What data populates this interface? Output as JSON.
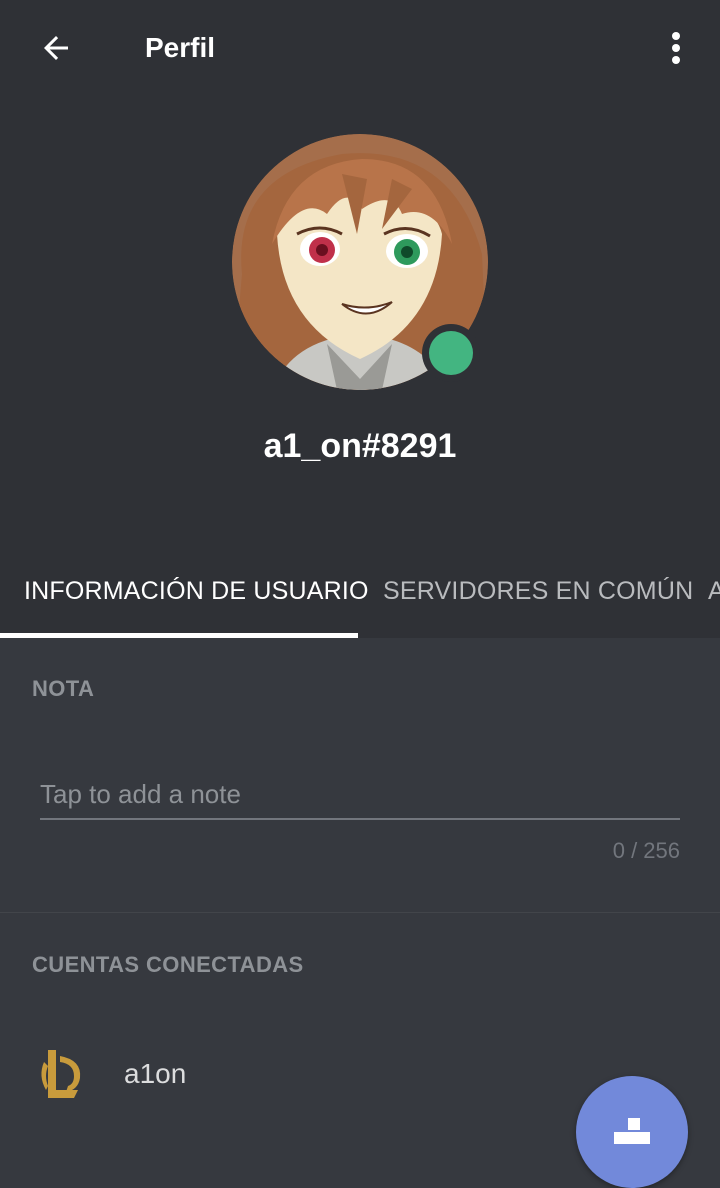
{
  "header": {
    "title": "Perfil",
    "back_icon": "arrow-left-icon",
    "more_icon": "more-vertical-icon"
  },
  "profile": {
    "username": "a1_on#8291",
    "status": "online",
    "status_color": "#43b581"
  },
  "tabs": [
    {
      "label": "INFORMACIÓN DE USUARIO",
      "active": true
    },
    {
      "label": "SERVIDORES EN COMÚN",
      "active": false
    },
    {
      "label": "A",
      "active": false
    }
  ],
  "note": {
    "section_label": "NOTA",
    "placeholder": "Tap to add a note",
    "value": "",
    "counter": "0 / 256"
  },
  "connected_accounts": {
    "section_label": "CUENTAS CONECTADAS",
    "items": [
      {
        "name": "a1on",
        "icon": "league-of-legends-icon"
      }
    ]
  },
  "fab": {
    "icon": "add-friend-icon",
    "color": "#7289da"
  },
  "colors": {
    "header_bg": "#2f3136",
    "body_bg": "#36393f",
    "online": "#43b581",
    "accent": "#7289da"
  }
}
